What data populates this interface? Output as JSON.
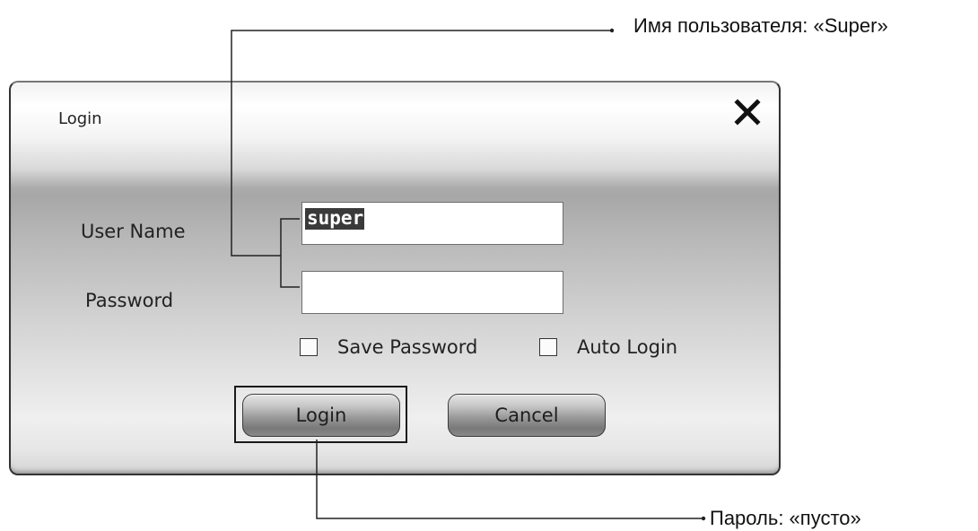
{
  "dialog": {
    "title": "Login",
    "close_glyph": "X",
    "username_label": "User Name",
    "password_label": "Password",
    "username_value": "super",
    "password_value": "",
    "save_password_label": "Save Password",
    "save_password_checked": false,
    "auto_login_label": "Auto Login",
    "auto_login_checked": false,
    "login_button": "Login",
    "cancel_button": "Cancel"
  },
  "annotations": {
    "username_note": "Имя пользователя: «Super»",
    "password_note": "Пароль: «пусто»"
  },
  "icons": {
    "close": "close-icon"
  }
}
